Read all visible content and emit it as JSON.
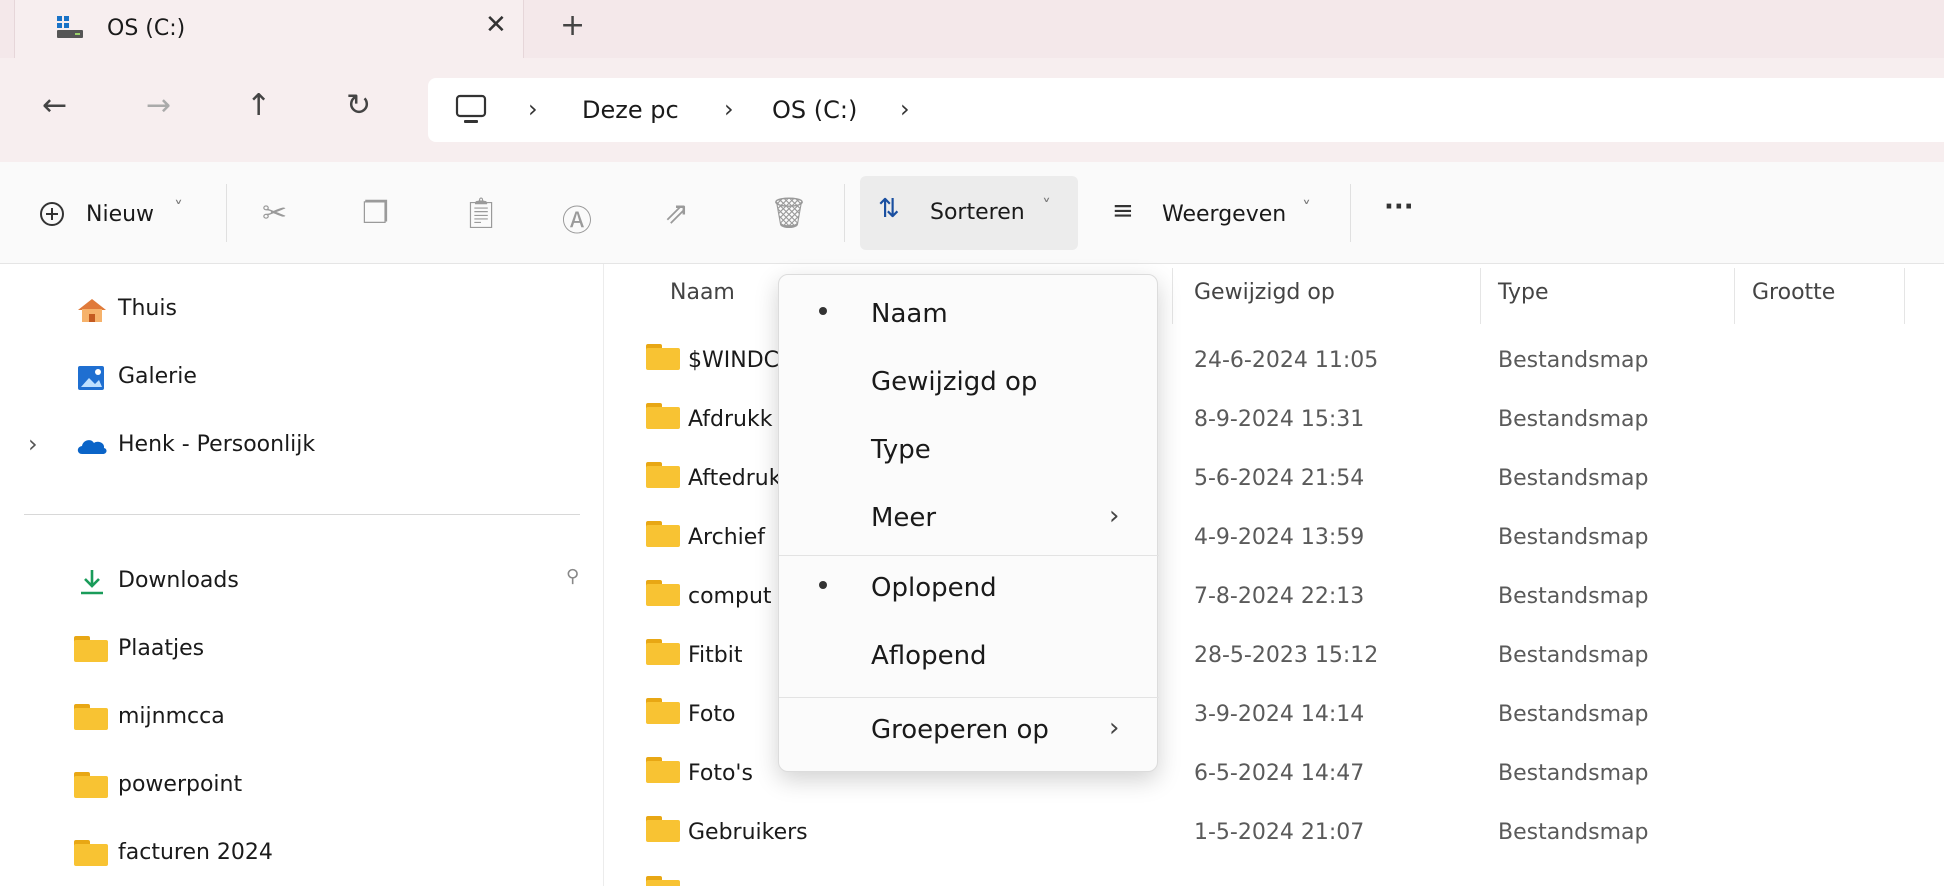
{
  "tab": {
    "title": "OS (C:)",
    "close_glyph": "✕",
    "new_glyph": "+"
  },
  "nav": {
    "back_glyph": "←",
    "forward_glyph": "→",
    "up_glyph": "↑",
    "refresh_glyph": "↻",
    "breadcrumbs": [
      "Deze pc",
      "OS (C:)"
    ],
    "sep_glyph": "›"
  },
  "toolbar": {
    "new_label": "Nieuw",
    "sort_label": "Sorteren",
    "view_label": "Weergeven",
    "more_glyph": "···",
    "chevron_glyph": "˅"
  },
  "sidebar": {
    "quick": [
      {
        "label": "Thuis",
        "icon": "home-icon"
      },
      {
        "label": "Galerie",
        "icon": "gallery-icon"
      },
      {
        "label": "Henk - Persoonlijk",
        "icon": "cloud-icon"
      }
    ],
    "pinned": [
      {
        "label": "Downloads",
        "icon": "download-icon"
      },
      {
        "label": "Plaatjes",
        "icon": "folder-icon"
      },
      {
        "label": "mijnmcca",
        "icon": "folder-icon"
      },
      {
        "label": "powerpoint",
        "icon": "folder-icon"
      },
      {
        "label": "facturen 2024",
        "icon": "folder-icon"
      }
    ],
    "expand_glyph": "›",
    "pin_glyph": "📌"
  },
  "columns": {
    "name": "Naam",
    "modified": "Gewijzigd op",
    "type": "Type",
    "size": "Grootte"
  },
  "files": [
    {
      "name": "$WINDC",
      "modified": "24-6-2024 11:05",
      "type": "Bestandsmap"
    },
    {
      "name": "Afdrukk",
      "modified": "8-9-2024 15:31",
      "type": "Bestandsmap"
    },
    {
      "name": "Aftedruk",
      "modified": "5-6-2024 21:54",
      "type": "Bestandsmap"
    },
    {
      "name": "Archief",
      "modified": "4-9-2024 13:59",
      "type": "Bestandsmap"
    },
    {
      "name": "comput",
      "modified": "7-8-2024 22:13",
      "type": "Bestandsmap"
    },
    {
      "name": "Fitbit",
      "modified": "28-5-2023 15:12",
      "type": "Bestandsmap"
    },
    {
      "name": "Foto",
      "modified": "3-9-2024 14:14",
      "type": "Bestandsmap"
    },
    {
      "name": "Foto's",
      "modified": "6-5-2024 14:47",
      "type": "Bestandsmap"
    },
    {
      "name": "Gebruikers",
      "modified": "1-5-2024 21:07",
      "type": "Bestandsmap"
    }
  ],
  "sort_menu": {
    "items": [
      "Naam",
      "Gewijzigd op",
      "Type",
      "Meer"
    ],
    "order": [
      "Oplopend",
      "Aflopend"
    ],
    "group": "Groeperen op",
    "selected_sort": "Naam",
    "selected_order": "Oplopend"
  },
  "colors": {
    "folder": "#f8c333",
    "accent": "#0067c0",
    "tab_bg": "#f7eeef"
  }
}
